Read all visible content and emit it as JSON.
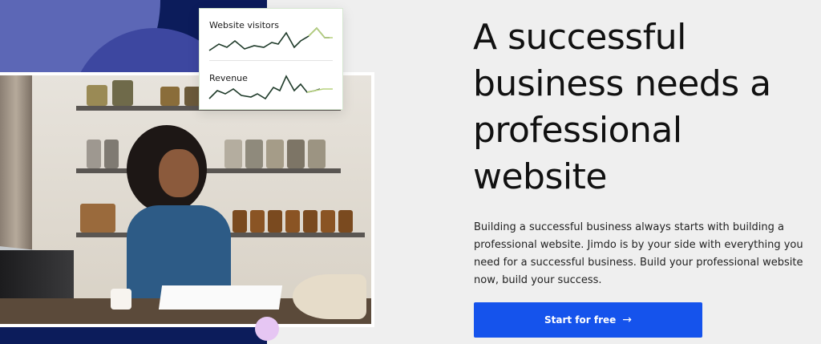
{
  "hero_image": {
    "stats_card": {
      "visitors_label": "Website visitors",
      "revenue_label": "Revenue"
    }
  },
  "hero": {
    "headline": "A successful business needs a professional website",
    "description": "Building a successful business always starts with building a professional website. Jimdo is by your side with everything you need for a successful business. Build your professional website now, build your success.",
    "cta_label": "Start for free",
    "cta_arrow": "→"
  },
  "colors": {
    "navy": "#0c1c5b",
    "accent_blue": "#1553ec",
    "chart_dark": "#1f3b2a",
    "chart_light": "#b7d27e"
  }
}
